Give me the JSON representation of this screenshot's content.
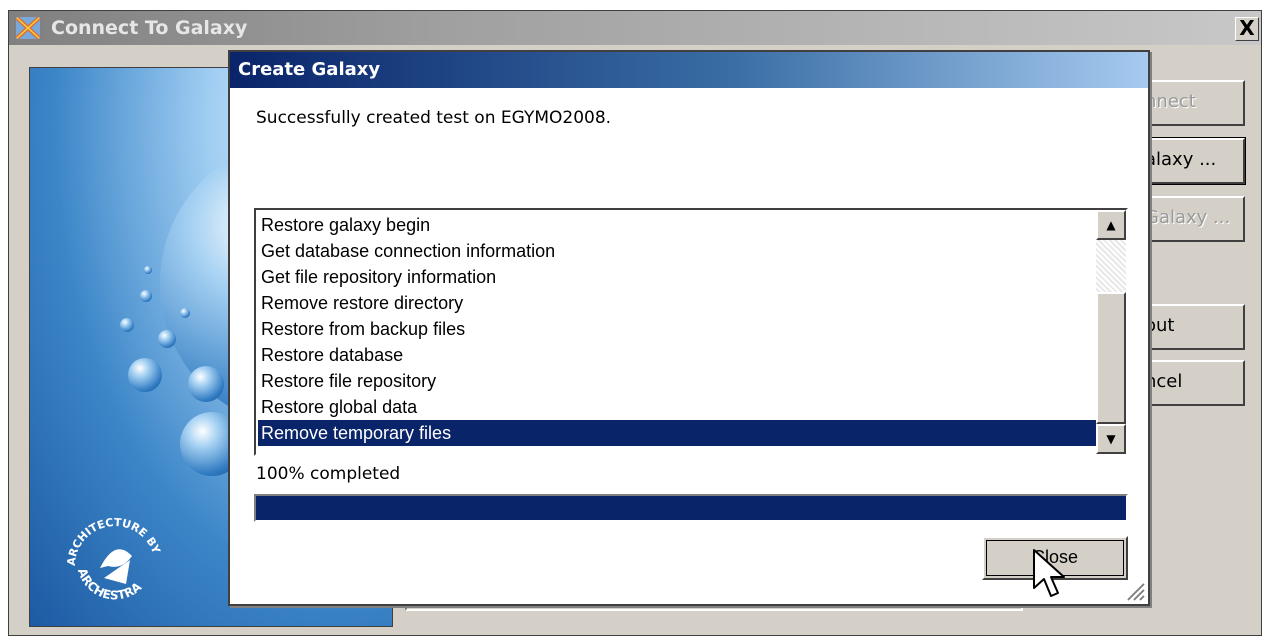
{
  "outer_window": {
    "title": "Connect To Galaxy",
    "close_symbol": "X",
    "side_buttons": [
      {
        "label": "nnect",
        "state": "disabled"
      },
      {
        "label": "alaxy ...",
        "state": "focused"
      },
      {
        "label": "Galaxy ...",
        "state": "disabled"
      },
      {
        "label": "out",
        "state": "normal"
      },
      {
        "label": "ncel",
        "state": "normal"
      }
    ],
    "splash_logo_text": [
      "ARCHITECTURE BY",
      "ARCHESTRA"
    ]
  },
  "dialog": {
    "title": "Create Galaxy",
    "message": "Successfully created test on EGYMO2008.",
    "log_items": [
      "Restore galaxy begin",
      "Get database connection information",
      "Get file repository information",
      "Remove restore directory",
      "Restore from backup files",
      "Restore database",
      "Restore file repository",
      "Restore global data",
      "Remove temporary files"
    ],
    "selected_index": 8,
    "progress_label": "100% completed",
    "progress_value": 1.0,
    "close_label": "Close"
  },
  "colors": {
    "selection": "#0a246a",
    "title_start": "#0a246a",
    "title_end": "#a6caf0",
    "face": "#d4d0c8"
  }
}
